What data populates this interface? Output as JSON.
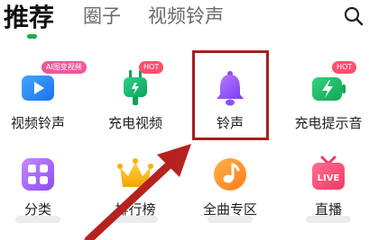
{
  "tabs": [
    {
      "label": "推荐",
      "active": true
    },
    {
      "label": "圈子",
      "active": false
    },
    {
      "label": "视频铃声",
      "active": false
    }
  ],
  "header": {
    "search_icon": "search-icon"
  },
  "row1": [
    {
      "label": "视频铃声",
      "icon": "video-icon",
      "badge": "AI图变视频",
      "badge_color": "#f0559a"
    },
    {
      "label": "充电视频",
      "icon": "charging-plug-icon",
      "badge": "HOT",
      "badge_color": "#ff4d6d"
    },
    {
      "label": "铃声",
      "icon": "bell-icon"
    },
    {
      "label": "充电提示音",
      "icon": "charging-battery-icon",
      "badge": "HOT",
      "badge_color": "#ff4d6d"
    }
  ],
  "row2": [
    {
      "label": "分类",
      "icon": "category-grid-icon"
    },
    {
      "label": "排行榜",
      "icon": "crown-icon"
    },
    {
      "label": "全曲专区",
      "icon": "music-note-icon"
    },
    {
      "label": "直播",
      "icon": "live-tv-icon",
      "icon_text": "LIVE"
    }
  ],
  "colors": {
    "accent": "#12b24d",
    "highlight_box": "#a3211e",
    "arrow": "#b5221f"
  }
}
